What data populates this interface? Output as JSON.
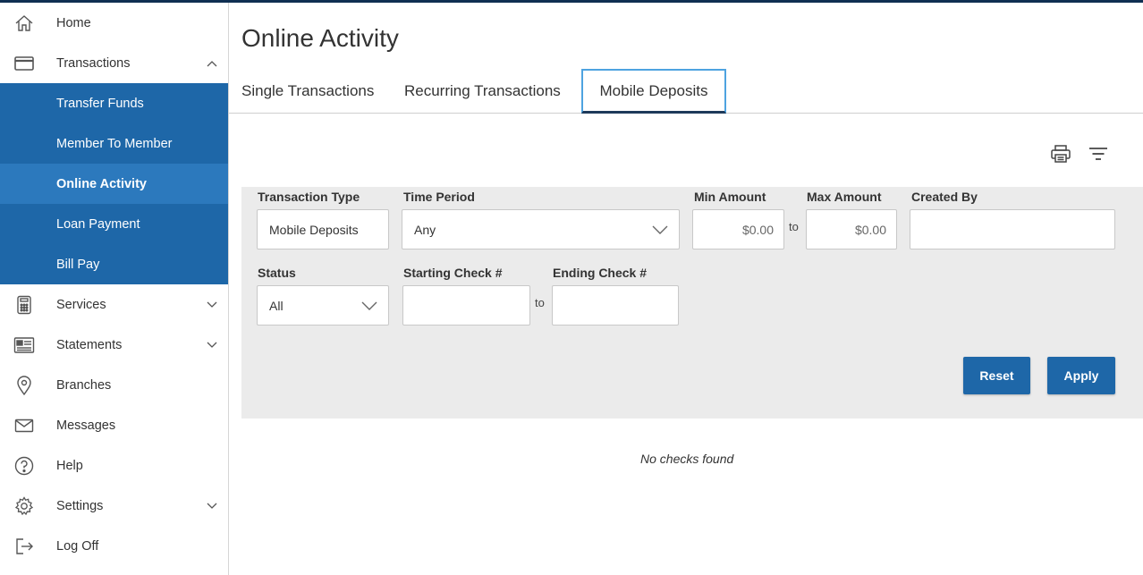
{
  "sidebar": {
    "items": [
      {
        "label": "Home",
        "icon": "home-icon"
      },
      {
        "label": "Transactions",
        "icon": "card-icon"
      },
      {
        "label": "Services",
        "icon": "calculator-icon"
      },
      {
        "label": "Statements",
        "icon": "statement-icon"
      },
      {
        "label": "Branches",
        "icon": "location-pin-icon"
      },
      {
        "label": "Messages",
        "icon": "envelope-icon"
      },
      {
        "label": "Help",
        "icon": "help-icon"
      },
      {
        "label": "Settings",
        "icon": "gear-icon"
      },
      {
        "label": "Log Off",
        "icon": "logout-icon"
      }
    ],
    "transactions_sub": [
      {
        "label": "Transfer Funds"
      },
      {
        "label": "Member To Member"
      },
      {
        "label": "Online Activity"
      },
      {
        "label": "Loan Payment"
      },
      {
        "label": "Bill Pay"
      }
    ]
  },
  "main": {
    "title": "Online Activity",
    "tabs": [
      {
        "label": "Single Transactions"
      },
      {
        "label": "Recurring Transactions"
      },
      {
        "label": "Mobile Deposits"
      }
    ],
    "filters": {
      "transaction_type_label": "Transaction Type",
      "transaction_type_value": "Mobile Deposits",
      "time_period_label": "Time Period",
      "time_period_value": "Any",
      "min_amount_label": "Min Amount",
      "min_amount_placeholder": "$0.00",
      "to_text": "to",
      "max_amount_label": "Max Amount",
      "max_amount_placeholder": "$0.00",
      "created_by_label": "Created By",
      "status_label": "Status",
      "status_value": "All",
      "starting_check_label": "Starting Check #",
      "ending_check_label": "Ending Check #",
      "reset_label": "Reset",
      "apply_label": "Apply"
    },
    "empty_message": "No checks found"
  },
  "colors": {
    "nav_submenu": "#1e67a8",
    "nav_active": "#2c79bd",
    "button": "#1e67a8",
    "tab_active_border": "#4ea3e0",
    "top_bar": "#0f2f52"
  }
}
